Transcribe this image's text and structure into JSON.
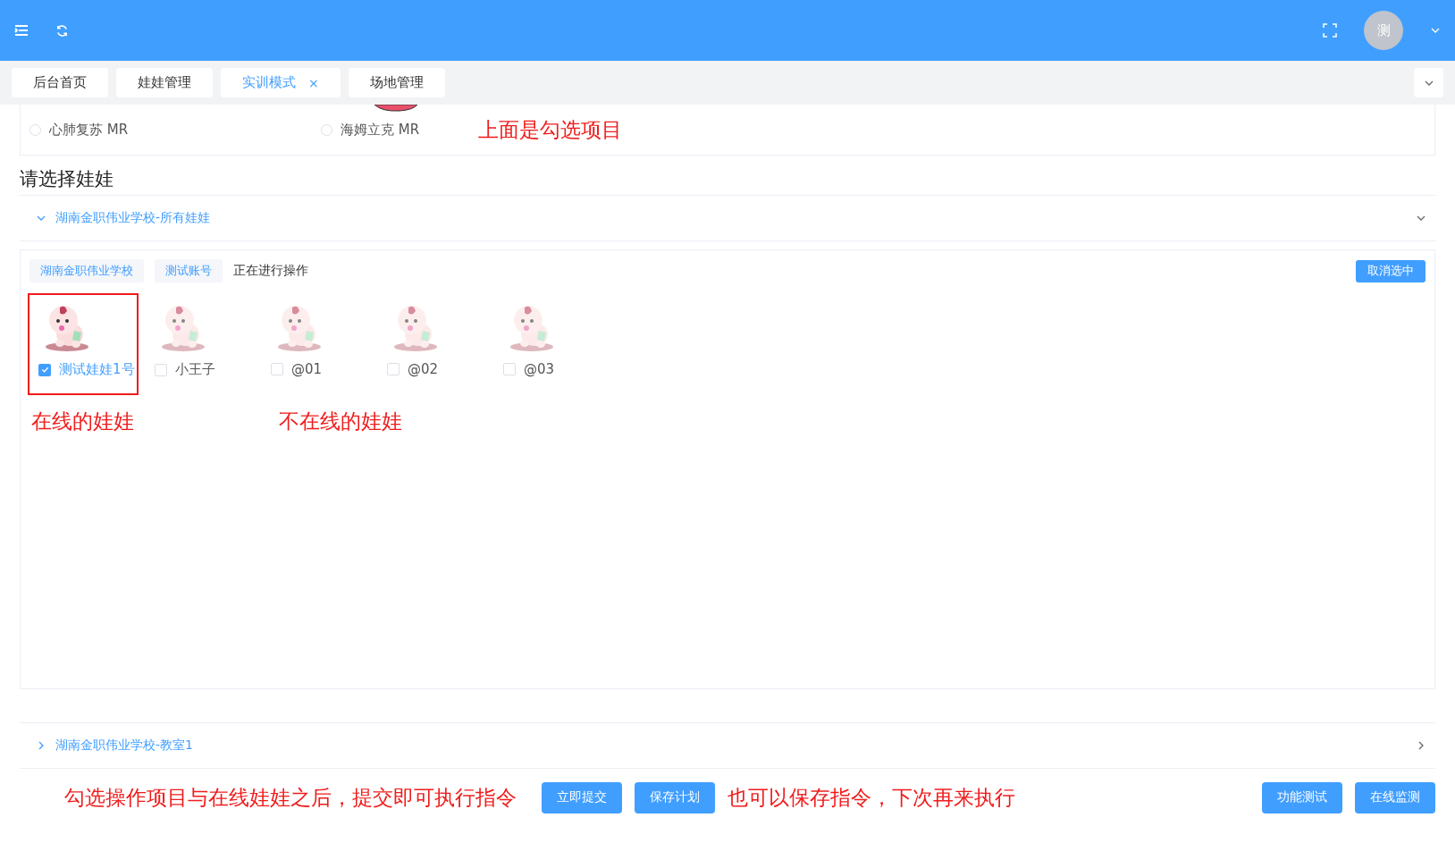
{
  "header": {
    "avatar_text": "测"
  },
  "tabs": [
    {
      "label": "后台首页",
      "selected": false
    },
    {
      "label": "娃娃管理",
      "selected": false
    },
    {
      "label": "实训模式",
      "selected": true,
      "close_text": "×"
    },
    {
      "label": "场地管理",
      "selected": false
    }
  ],
  "projects": [
    {
      "label": "心肺复苏 MR",
      "selected": false
    },
    {
      "label": "海姆立克 MR",
      "selected": false
    }
  ],
  "projects_note": "上面是勾选项目",
  "section_title": "请选择娃娃",
  "groups": [
    {
      "title": "湖南金职伟业学校-所有娃娃",
      "expanded": true,
      "tags": [
        "湖南金职伟业学校",
        "测试账号"
      ],
      "status_text": "正在进行操作",
      "cancel_button": "取消选中",
      "dolls": [
        {
          "name": "测试娃娃1号",
          "checked": true,
          "online": true
        },
        {
          "name": "小王子",
          "checked": false,
          "online": false
        },
        {
          "name": "@01",
          "checked": false,
          "online": false
        },
        {
          "name": "@02",
          "checked": false,
          "online": false
        },
        {
          "name": "@03",
          "checked": false,
          "online": false
        }
      ],
      "notes": [
        "在线的娃娃",
        "不在线的娃娃"
      ]
    },
    {
      "title": "湖南金职伟业学校-教室1",
      "expanded": false
    }
  ],
  "footer": {
    "note_left": "勾选操作项目与在线娃娃之后，提交即可执行指令",
    "buttons_left": [
      "立即提交",
      "保存计划"
    ],
    "note_right": "也可以保存指令，下次再来执行",
    "buttons_right": [
      "功能测试",
      "在线监测"
    ]
  }
}
